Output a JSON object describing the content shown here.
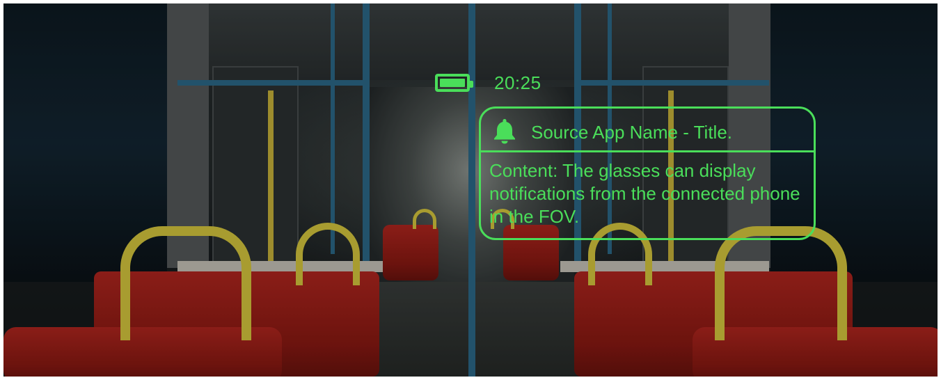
{
  "hud": {
    "status": {
      "battery_icon": "battery-full-icon",
      "time": "20:25"
    },
    "notification": {
      "icon": "bell-icon",
      "title": "Source App Name - Title.",
      "content": "Content: The glasses can display notifications from the connected phone in the FOV."
    },
    "accent_color": "#4ade5a"
  }
}
